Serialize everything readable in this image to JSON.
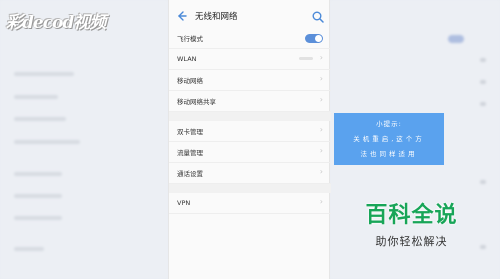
{
  "watermark": {
    "text": "彩decod视频"
  },
  "header": {
    "title": "无线和网络"
  },
  "settings": [
    {
      "label": "飞行模式"
    },
    {
      "label": "WLAN"
    },
    {
      "label": "移动网络"
    },
    {
      "label": "移动网络共享"
    },
    {
      "label": "双卡管理"
    },
    {
      "label": "流量管理"
    },
    {
      "label": "通话设置"
    },
    {
      "label": "VPN"
    }
  ],
  "tip": {
    "title": "小提示:",
    "line1": "关机重启,这个方",
    "line2": "法也同样适用"
  },
  "brand": {
    "name": "百科全说",
    "slogan": "助你轻松解决"
  },
  "icons": {
    "back": "back-arrow-icon",
    "search": "search-icon",
    "chevron": "chevron-right-icon"
  },
  "colors": {
    "accent": "#4a89d8",
    "tip_bg": "#5aa2ee",
    "brand_green": "#18a558"
  }
}
